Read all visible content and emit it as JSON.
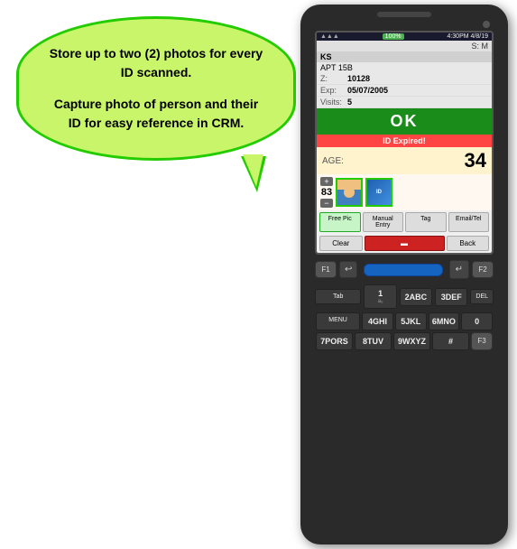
{
  "bubble": {
    "line1": "Store up to two (2) photos for every ID scanned.",
    "line2": "Capture photo of person and their ID for easy reference in CRM."
  },
  "screen": {
    "header": {
      "signal": "▲▲▲",
      "battery": "100%",
      "time": "4:30PM 4/8/19"
    },
    "s_row": "S: M",
    "name": "KS",
    "apt": "APT 15B",
    "zip_label": "Z:",
    "zip_value": "10128",
    "exp_label": "Exp:",
    "exp_value": "05/07/2005",
    "visits_label": "Visits:",
    "visits_value": "5",
    "ok_text": "OK",
    "id_expired": "ID Expired!",
    "age_label": "AGE:",
    "age_value": "34",
    "counter_plus": "+",
    "counter_minus": "−",
    "counter_value": "83",
    "buttons": {
      "free_pic": "Free Pic",
      "manual_entry": "Manual Entry",
      "tag": "Tag",
      "email_tel": "Email/Tel"
    },
    "actions": {
      "clear": "Clear",
      "back": "Back"
    }
  },
  "keypad": {
    "f1": "F1",
    "f2": "F2",
    "f3": "F3",
    "back_arrow": "↩",
    "forward_arrow": "↪",
    "enter": "↵",
    "del": "DEL",
    "tab": "Tab",
    "menu": "MENU",
    "keys": [
      {
        "main": "1",
        "sub": "aₒ"
      },
      {
        "main": "2ABC",
        "sub": ""
      },
      {
        "main": "3DEF",
        "sub": ""
      },
      {
        "main": "*",
        "sub": ""
      },
      {
        "main": "4GHI",
        "sub": ""
      },
      {
        "main": "5JKL",
        "sub": ""
      },
      {
        "main": "6MNO",
        "sub": ""
      },
      {
        "main": "0",
        "sub": ""
      },
      {
        "main": "7PORS",
        "sub": ""
      },
      {
        "main": "8TUV",
        "sub": ""
      },
      {
        "main": "9WXYZ",
        "sub": ""
      },
      {
        "main": "#",
        "sub": ""
      }
    ],
    "one_a": "1-A"
  }
}
